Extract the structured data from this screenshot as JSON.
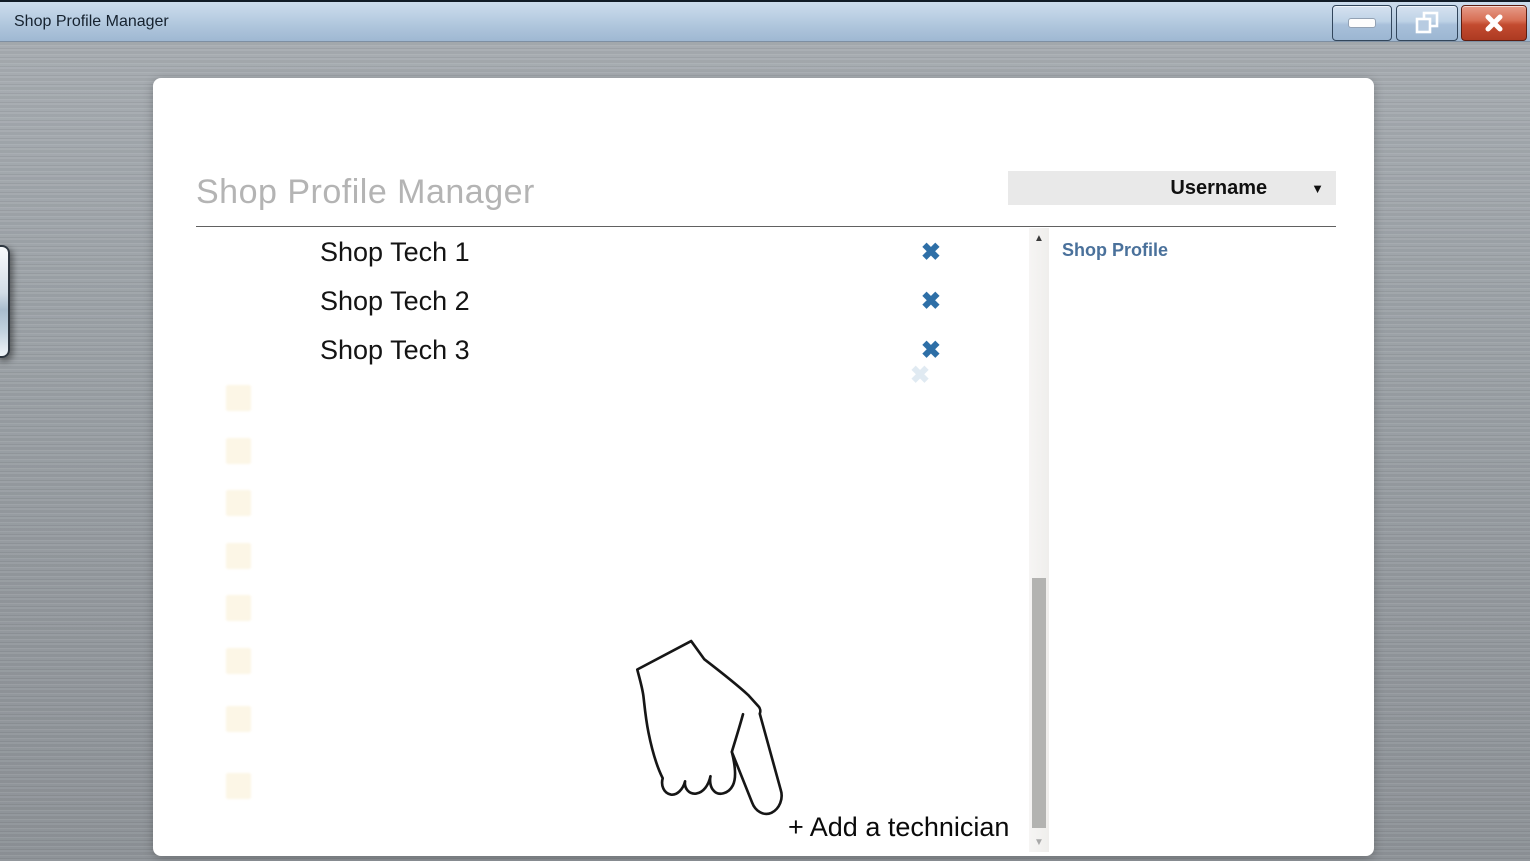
{
  "titlebar": {
    "title": "Shop Profile Manager"
  },
  "panel": {
    "heading": "Shop Profile Manager",
    "username_dropdown": {
      "value": "Username"
    },
    "right_panel_title": "Shop Profile",
    "add_technician_label": "+ Add a technician"
  },
  "technicians": [
    {
      "name": "Shop Tech 1"
    },
    {
      "name": "Shop Tech 2"
    },
    {
      "name": "Shop Tech 3"
    }
  ],
  "icons": {
    "delete": "✖",
    "dropdown_arrow": "▼",
    "scroll_up": "▲",
    "scroll_down": "▼"
  },
  "colors": {
    "delete_x": "#2e6fa7",
    "right_panel_title": "#4a719b",
    "titlebar_blue": "#b6cbe2",
    "close_button_red": "#c0402a",
    "heading_gray": "#b4b4b4"
  }
}
